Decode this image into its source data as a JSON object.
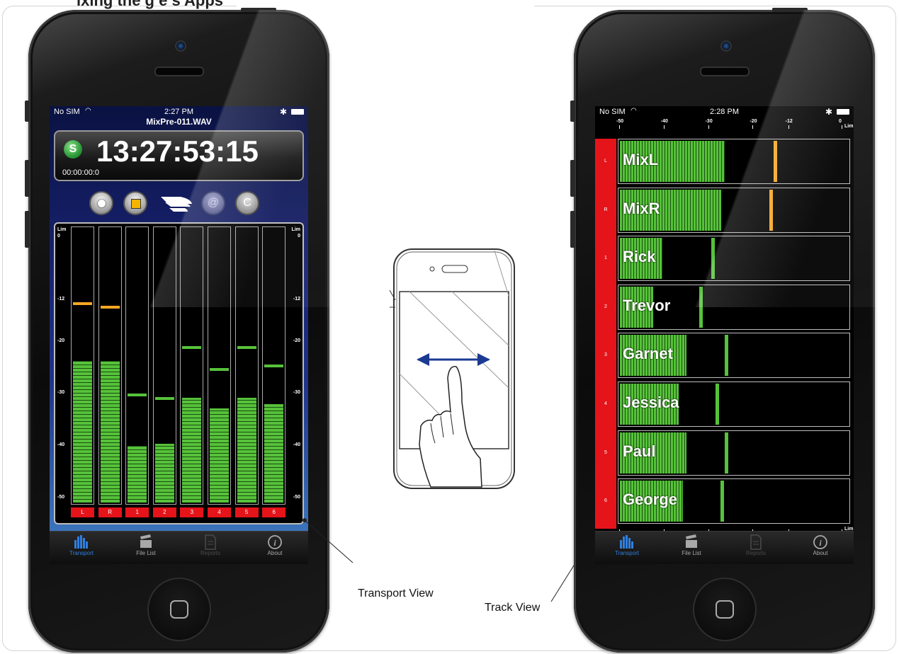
{
  "top_text": "ixing the g     e s Apps  ",
  "left_phone": {
    "status": {
      "carrier": "No SIM",
      "time": "2:27 PM"
    },
    "filename": "MixPre-011.WAV",
    "timecode": "13:27:53:15",
    "timecode_sub": "00:00:00:0",
    "controls": {
      "at_label": "@",
      "cycle_label": "C"
    },
    "scale_labels": [
      "Lim",
      "0",
      "-12",
      "-20",
      "-30",
      "-40",
      "-50"
    ],
    "meters": [
      {
        "label": "L",
        "level_db": -24,
        "peak_db": -12.5,
        "peak_color": "#f5a623"
      },
      {
        "label": "R",
        "level_db": -24,
        "peak_db": -13.2,
        "peak_color": "#f5a623"
      },
      {
        "label": "1",
        "level_db": -40.3,
        "peak_db": -30,
        "peak_color": "#56c23a"
      },
      {
        "label": "2",
        "level_db": -39.8,
        "peak_db": -30.6,
        "peak_color": "#56c23a"
      },
      {
        "label": "3",
        "level_db": -31,
        "peak_db": -20.8,
        "peak_color": "#56c23a"
      },
      {
        "label": "4",
        "level_db": -33,
        "peak_db": -25.1,
        "peak_color": "#56c23a"
      },
      {
        "label": "5",
        "level_db": -31,
        "peak_db": -20.8,
        "peak_color": "#56c23a"
      },
      {
        "label": "6",
        "level_db": -32.2,
        "peak_db": -24.4,
        "peak_color": "#56c23a"
      }
    ],
    "tabs": [
      {
        "label": "Transport",
        "icon": "bars-icon",
        "state": "active"
      },
      {
        "label": "File List",
        "icon": "clapper-icon",
        "state": "normal"
      },
      {
        "label": "Reports",
        "icon": "document-icon",
        "state": "disabled"
      },
      {
        "label": "About",
        "icon": "info-icon",
        "state": "normal"
      }
    ]
  },
  "right_phone": {
    "status": {
      "carrier": "No SIM",
      "time": "2:28 PM"
    },
    "scale_labels": [
      "-50",
      "-40",
      "-30",
      "-20",
      "-12",
      "0",
      "Lim"
    ],
    "tracks": [
      {
        "num": "L",
        "name": "MixL",
        "level_db": -26.5,
        "peak_db": -15.5,
        "peak_color": "#f5a623"
      },
      {
        "num": "R",
        "name": "MixR",
        "level_db": -27.2,
        "peak_db": -16.4,
        "peak_color": "#f5a623"
      },
      {
        "num": "1",
        "name": "Rick",
        "level_db": -40.5,
        "peak_db": -29.4,
        "peak_color": "#56c23a"
      },
      {
        "num": "2",
        "name": "Trevor",
        "level_db": -42.5,
        "peak_db": -32.2,
        "peak_color": "#56c23a"
      },
      {
        "num": "3",
        "name": "Garnet",
        "level_db": -35,
        "peak_db": -26.5,
        "peak_color": "#56c23a"
      },
      {
        "num": "4",
        "name": "Jessica",
        "level_db": -36.8,
        "peak_db": -28.5,
        "peak_color": "#56c23a"
      },
      {
        "num": "5",
        "name": "Paul",
        "level_db": -35,
        "peak_db": -26.5,
        "peak_color": "#56c23a"
      },
      {
        "num": "6",
        "name": "George",
        "level_db": -35.8,
        "peak_db": -27.4,
        "peak_color": "#56c23a"
      }
    ],
    "tabs": [
      {
        "label": "Transport",
        "icon": "bars-icon",
        "state": "active"
      },
      {
        "label": "File List",
        "icon": "clapper-icon",
        "state": "normal"
      },
      {
        "label": "Reports",
        "icon": "document-icon",
        "state": "disabled"
      },
      {
        "label": "About",
        "icon": "info-icon",
        "state": "normal"
      }
    ]
  },
  "callouts": {
    "transport": "Transport View",
    "track": "Track View"
  }
}
